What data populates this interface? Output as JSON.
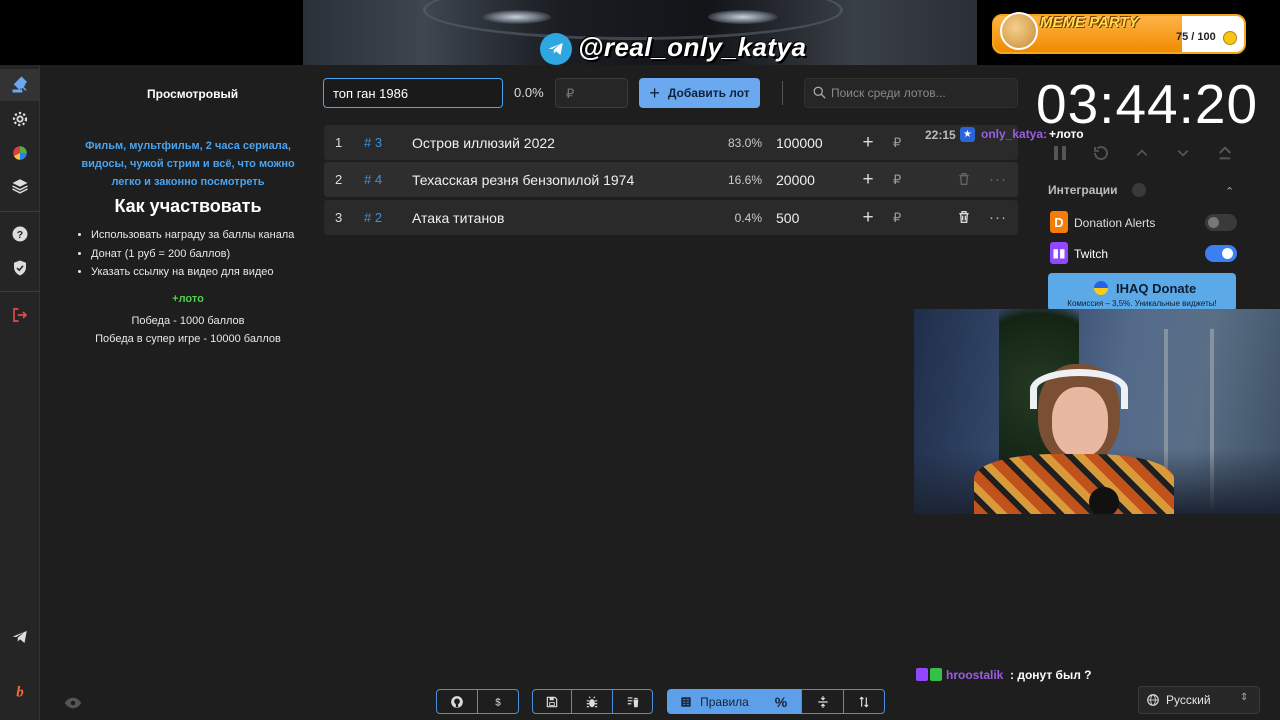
{
  "banner": {
    "telegram_handle": "@real_only_katya",
    "meme_party": {
      "title": "MEME PARTY",
      "count": "75 / 100",
      "progress": 0.75
    }
  },
  "sidebar": {
    "items": [
      {
        "name": "auction-icon"
      },
      {
        "name": "settings-icon"
      },
      {
        "name": "pie-chart-icon"
      },
      {
        "name": "layers-icon"
      },
      {
        "name": "help-icon"
      },
      {
        "name": "shield-icon"
      },
      {
        "name": "logout-icon"
      },
      {
        "name": "telegram-icon"
      },
      {
        "name": "brand-logo-icon"
      }
    ]
  },
  "info": {
    "heading": "Просмотровый",
    "description": "Фильм, мультфильм, 2 часа сериала, видосы, чужой стрим и всё, что можно легко и законно посмотреть",
    "title": "Как участвовать",
    "list": [
      "Использовать награду за баллы канала",
      "Донат (1 руб = 200 баллов)",
      "Указать ссылку на видео для видео"
    ],
    "loto": "+лото",
    "win": "Победа - 1000 баллов",
    "super": "Победа в супер игре - 10000 баллов"
  },
  "controls": {
    "lot_name_value": "топ ган 1986",
    "percent": "0.0%",
    "amount_placeholder": "₽",
    "add_button": "Добавить лот",
    "search_placeholder": "Поиск среди лотов..."
  },
  "lots": [
    {
      "num": "1",
      "id": "# 3",
      "name": "Остров иллюзий 2022",
      "pct": "83.0%",
      "amount": "100000",
      "plus": "+",
      "currency": "₽"
    },
    {
      "num": "2",
      "id": "# 4",
      "name": "Техасская резня бензопилой 1974",
      "pct": "16.6%",
      "amount": "20000",
      "plus": "+",
      "currency": "₽"
    },
    {
      "num": "3",
      "id": "# 2",
      "name": "Атака титанов",
      "pct": "0.4%",
      "amount": "500",
      "plus": "+",
      "currency": "₽"
    }
  ],
  "more_glyph": "···",
  "chat": [
    {
      "time": "22:15",
      "user": "only_katya:",
      "message": "+лото"
    },
    {
      "user": "hroostalik",
      "message": ": донут был ?"
    }
  ],
  "timer": {
    "value": "03:44:20"
  },
  "integrations": {
    "title": "Интеграции",
    "donation_alerts": {
      "label": "Donation Alerts",
      "enabled": false
    },
    "twitch": {
      "label": "Twitch",
      "enabled": true
    },
    "ihaq": {
      "title": "IHAQ Donate",
      "subtitle": "Комиссия – 3,5%. Уникальные виджеты!"
    }
  },
  "toolbar": {
    "rules_label": "Правила",
    "percent_label": "%"
  },
  "language": {
    "label": "Русский"
  },
  "colors": {
    "accent": "#5e9fe9",
    "loto_green": "#4cd14c",
    "username_purple": "#9b5de5",
    "link_blue": "#4aa3ef"
  }
}
